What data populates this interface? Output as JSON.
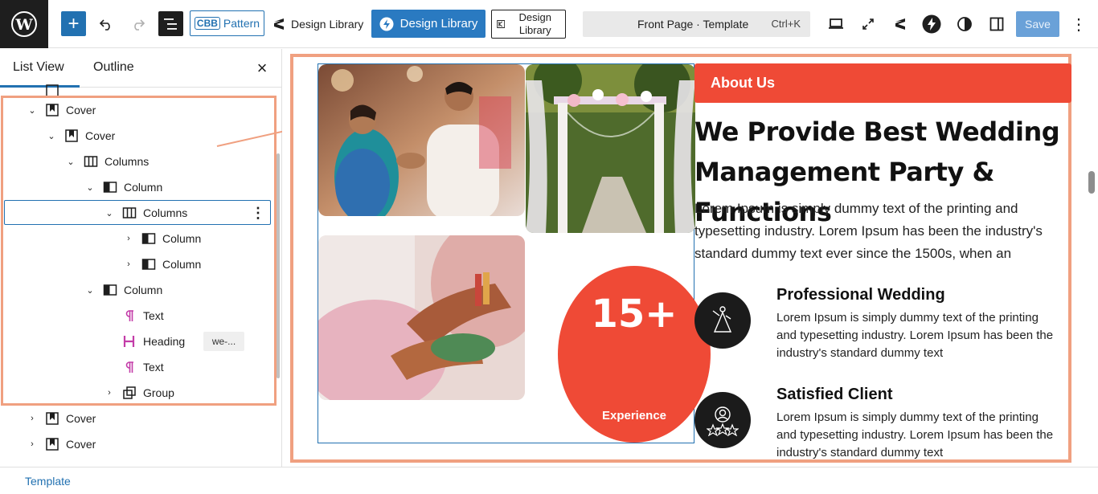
{
  "toolbar": {
    "pattern_label": "Pattern",
    "pattern_badge": "CBB",
    "design_library_1": "Design Library",
    "design_library_2": "Design Library",
    "design_library_3": "Design Library",
    "command_title": "Front Page · Template",
    "command_shortcut": "Ctrl+K",
    "save_label": "Save"
  },
  "sidebar": {
    "tab_list": "List View",
    "tab_outline": "Outline",
    "items": [
      {
        "label": "Cover",
        "icon": "cover-icon"
      },
      {
        "label": "Cover",
        "icon": "cover-icon"
      },
      {
        "label": "Columns",
        "icon": "columns-icon"
      },
      {
        "label": "Column",
        "icon": "column-icon"
      },
      {
        "label": "Columns",
        "icon": "columns-icon"
      },
      {
        "label": "Column",
        "icon": "column-icon"
      },
      {
        "label": "Column",
        "icon": "column-icon"
      },
      {
        "label": "Column",
        "icon": "column-icon"
      },
      {
        "label": "Text",
        "icon": "paragraph-icon"
      },
      {
        "label": "Heading",
        "icon": "heading-icon"
      },
      {
        "label": "Text",
        "icon": "paragraph-icon"
      },
      {
        "label": "Group",
        "icon": "group-icon"
      },
      {
        "label": "Cover",
        "icon": "cover-icon"
      },
      {
        "label": "Cover",
        "icon": "cover-icon"
      }
    ],
    "heading_chip": "we-..."
  },
  "footer": {
    "breadcrumb": "Template"
  },
  "content": {
    "about_label": "About Us",
    "heading": "We Provide Best Wedding Management Party & Functions",
    "paragraph": "Lorem Ipsum is simply dummy text of the printing and typesetting industry. Lorem Ipsum has been the industry's standard dummy text ever since the 1500s, when an",
    "stat_number": "15+",
    "stat_label": "Experience",
    "features": [
      {
        "title": "Professional Wedding",
        "text": "Lorem Ipsum is simply dummy text of the printing and typesetting industry. Lorem Ipsum has been the industry's standard dummy text"
      },
      {
        "title": "Satisfied Client",
        "text": "Lorem Ipsum is simply dummy text of the printing and typesetting industry. Lorem Ipsum has been the industry's standard dummy text"
      }
    ]
  },
  "colors": {
    "accent": "#ef4a36",
    "wp_blue": "#2271b1",
    "highlight": "#f0a080"
  }
}
